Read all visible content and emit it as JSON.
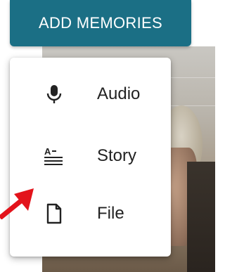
{
  "header": {
    "add_memories_label": "ADD MEMORIES"
  },
  "menu": {
    "items": [
      {
        "label": "Audio",
        "icon": "microphone-icon"
      },
      {
        "label": "Story",
        "icon": "text-format-icon"
      },
      {
        "label": "File",
        "icon": "file-icon"
      }
    ]
  },
  "colors": {
    "button_bg": "#1b6f85",
    "arrow": "#e3131b",
    "text": "#222222"
  }
}
